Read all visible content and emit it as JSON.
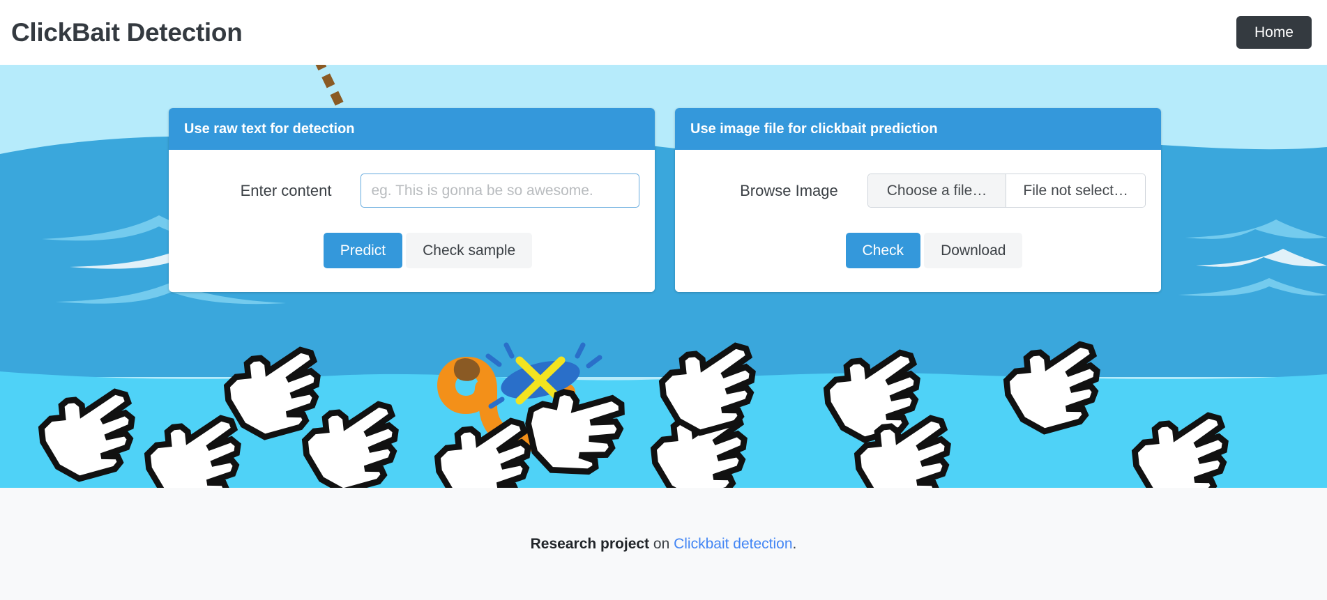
{
  "navbar": {
    "brand": "ClickBait Detection",
    "home_label": "Home"
  },
  "hero": {
    "colors": {
      "sky": "#b6ebfb",
      "water_mid": "#3aa7dc",
      "water_deep": "#4fd2f7",
      "hook": "#f39019",
      "hook_top": "#8a5a24",
      "bait_body": "#2a6fc9",
      "bait_mark": "#f3e320",
      "cursor_fill": "#ffffff",
      "cursor_outline": "#111111",
      "line": "#8a5a24"
    },
    "decor": {
      "fishing_line": "dashed-fishing-line",
      "hook": "fish-hook",
      "bait": "bait-fish",
      "cursors_count": 12
    }
  },
  "cards": [
    {
      "id": "raw-text",
      "title": "Use raw text for detection",
      "field_label": "Enter content",
      "input_placeholder": "eg. This is gonna be so awesome.",
      "input_value": "",
      "primary_button": "Predict",
      "secondary_button": "Check sample"
    },
    {
      "id": "image-file",
      "title": "Use image file for clickbait prediction",
      "field_label": "Browse Image",
      "choose_file_label": "Choose a file…",
      "file_status": "File not select…",
      "primary_button": "Check",
      "secondary_button": "Download"
    }
  ],
  "footer": {
    "bold_text": "Research project",
    "middle_text": " on ",
    "link_text": "Clickbait detection",
    "trailing_text": "."
  }
}
